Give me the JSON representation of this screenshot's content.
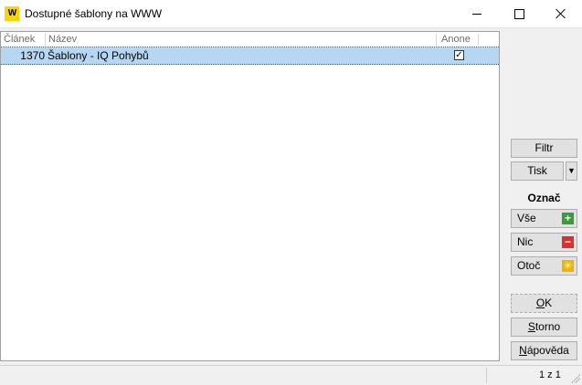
{
  "window": {
    "logo_text": "W",
    "title": "Dostupné šablony na WWW"
  },
  "grid": {
    "columns": [
      "Článek",
      "Název",
      "Anone"
    ],
    "rows": [
      {
        "clanek": "1370",
        "nazev": "Šablony - IQ Pohybů",
        "anone": true,
        "check_glyph": "✓"
      }
    ]
  },
  "sidebar": {
    "filtr_label": "Filtr",
    "tisk_label": "Tisk",
    "tisk_dropdown_glyph": "▼",
    "group_label": "Označ",
    "vse": {
      "label": "Vše",
      "icon": "plus-icon",
      "glyph": "+",
      "color": "#3a9b3a"
    },
    "nic": {
      "label": "Nic",
      "icon": "minus-icon",
      "glyph": "−",
      "color": "#d93030"
    },
    "otoc": {
      "label": "Otoč",
      "icon": "invert-icon",
      "glyph": "✳",
      "color": "#f0b400"
    },
    "ok": {
      "first": "O",
      "rest": "K"
    },
    "storno": {
      "first": "S",
      "rest": "torno"
    },
    "napoveda": {
      "first": "N",
      "rest": "ápověda"
    }
  },
  "status": {
    "count": "1 z 1"
  },
  "colors": {
    "selected_row": "#b7d6f2",
    "logo_bg": "#ffd400"
  }
}
